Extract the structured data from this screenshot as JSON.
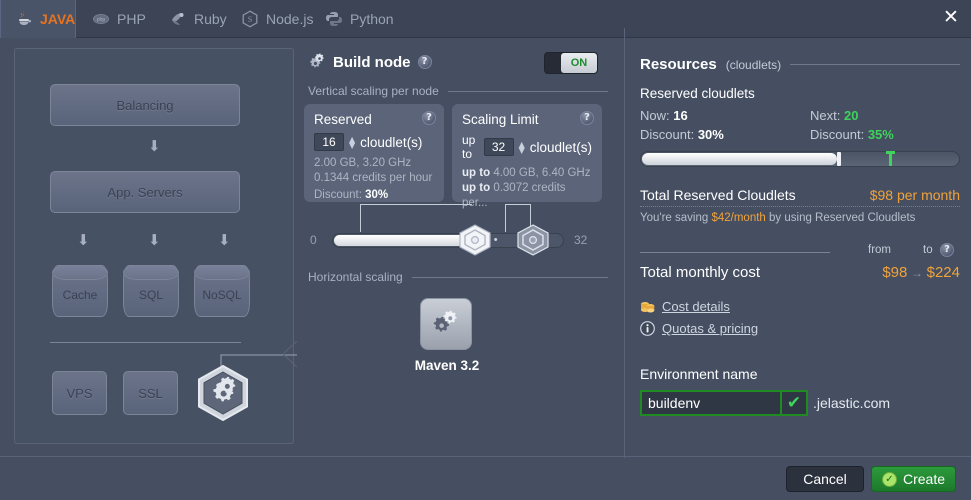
{
  "window": {
    "close_label": "✕"
  },
  "tabs": [
    {
      "label": "JAVA",
      "icon": "java-icon",
      "active": true
    },
    {
      "label": "PHP",
      "icon": "php-icon",
      "active": false
    },
    {
      "label": "Ruby",
      "icon": "ruby-icon",
      "active": false
    },
    {
      "label": "Node.js",
      "icon": "nodejs-icon",
      "active": false
    },
    {
      "label": "Python",
      "icon": "python-icon",
      "active": false
    }
  ],
  "topology": {
    "balancing": "Balancing",
    "app_servers": "App. Servers",
    "cache": "Cache",
    "sql": "SQL",
    "nosql": "NoSQL",
    "vps": "VPS",
    "ssl": "SSL",
    "build_node_icon": "gears-icon"
  },
  "build_node": {
    "title": "Build node",
    "help": "?",
    "toggle_label": "ON",
    "vertical_section": "Vertical scaling per node",
    "reserved": {
      "title": "Reserved",
      "value": "16",
      "unit": "cloudlet(s)",
      "specs": "2.00 GB, 3.20 GHz",
      "credits": "0.1344 credits per hour",
      "discount_label": "Discount:",
      "discount_value": "30%"
    },
    "scaling_limit": {
      "title": "Scaling Limit",
      "prefix": "up to",
      "value": "32",
      "unit": "cloudlet(s)",
      "specs_prefix": "up to",
      "specs": "4.00 GB, 6.40 GHz",
      "credits_prefix": "up to",
      "credits": "0.3072 credits per..."
    },
    "slider": {
      "min": "0",
      "max": "32",
      "dots": "•••"
    },
    "horizontal_section": "Horizontal scaling",
    "stack_name": "Maven 3.2",
    "stack_icon": "gears-icon"
  },
  "resources": {
    "title": "Resources",
    "title_sub": "(cloudlets)",
    "reserved_heading": "Reserved cloudlets",
    "now_label": "Now:",
    "now_value": "16",
    "next_label": "Next:",
    "next_value": "20",
    "discount_now_label": "Discount:",
    "discount_now_value": "30%",
    "discount_next_label": "Discount:",
    "discount_next_value": "35%",
    "total_reserved_label": "Total Reserved Cloudlets",
    "total_reserved_value": "$98 per month",
    "saving_pre": "You're saving ",
    "saving_amount": "$42/month",
    "saving_post": " by using Reserved Cloudlets",
    "from_label": "from",
    "to_label": "to",
    "total_monthly_label": "Total monthly cost",
    "cost_from": "$98",
    "cost_arrow": "→",
    "cost_to": "$224",
    "cost_details_link": "Cost details",
    "quotas_link": "Quotas & pricing",
    "env_name_label": "Environment name",
    "env_name_value": "buildenv",
    "env_name_placeholder": "Environment name",
    "env_domain": ".jelastic.com",
    "valid_mark": "✔"
  },
  "footer": {
    "cancel_label": "Cancel",
    "create_label": "Create"
  },
  "colors": {
    "accent_orange": "#e8731f",
    "amber": "#f0a23c",
    "green": "#3fd35c",
    "panel_bg": "#454f61"
  }
}
